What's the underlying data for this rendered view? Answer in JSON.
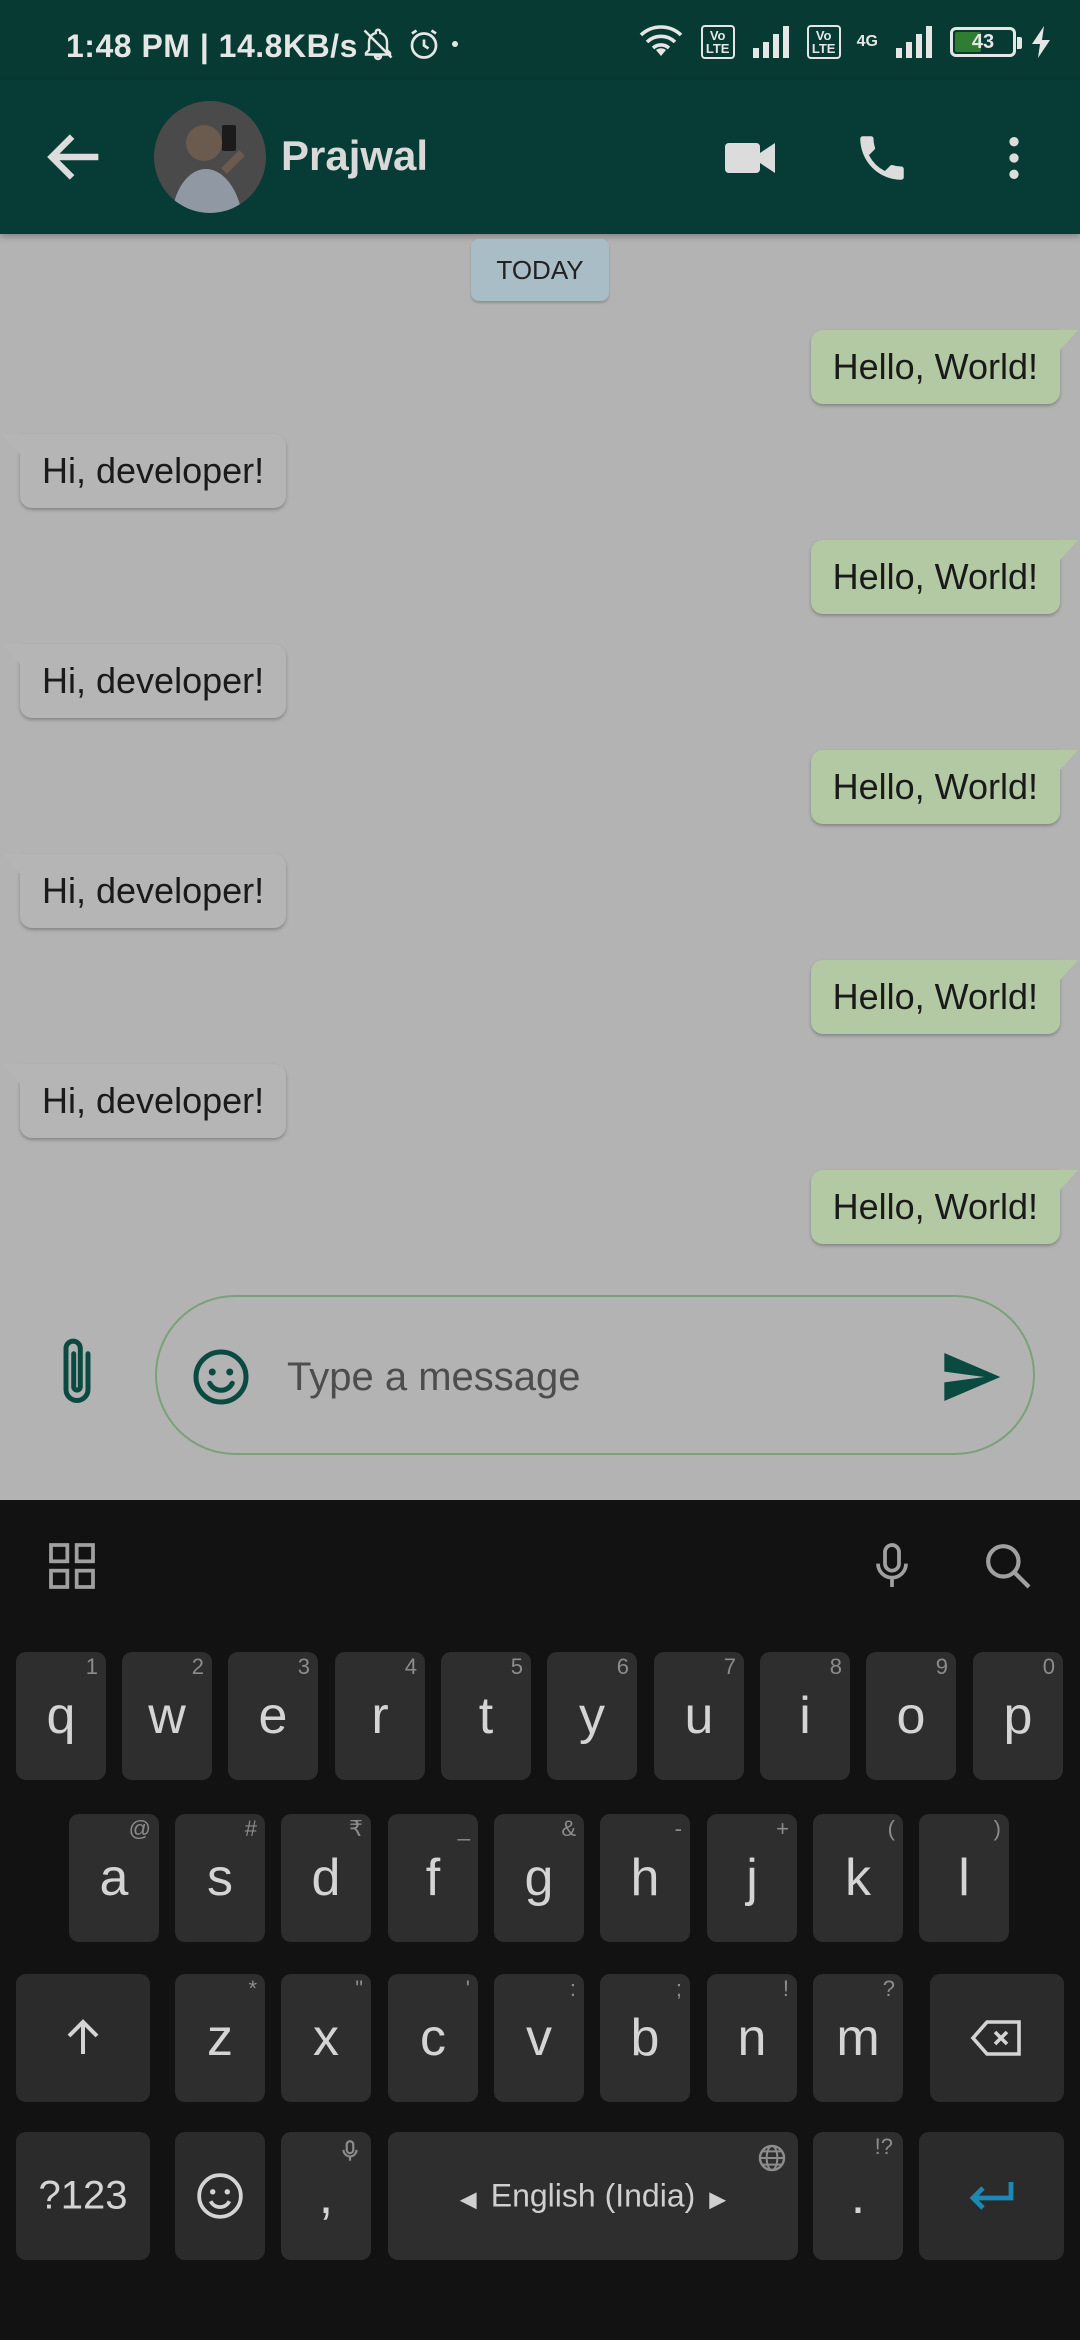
{
  "status_bar": {
    "time": "1:48 PM | 14.8KB/s",
    "volte_label": "Vo LTE",
    "network_4g": "4G",
    "battery": "43"
  },
  "header": {
    "contact_name": "Prajwal",
    "back_icon": "arrow-left-icon",
    "video_icon": "video-camera-icon",
    "call_icon": "phone-icon",
    "menu_icon": "more-vert-icon"
  },
  "chat": {
    "date_label": "TODAY",
    "messages": [
      {
        "dir": "out",
        "text": "Hello, World!"
      },
      {
        "dir": "in",
        "text": "Hi, developer!"
      },
      {
        "dir": "out",
        "text": "Hello, World!"
      },
      {
        "dir": "in",
        "text": "Hi, developer!"
      },
      {
        "dir": "out",
        "text": "Hello, World!"
      },
      {
        "dir": "in",
        "text": "Hi, developer!"
      },
      {
        "dir": "out",
        "text": "Hello, World!"
      },
      {
        "dir": "in",
        "text": "Hi, developer!"
      },
      {
        "dir": "out",
        "text": "Hello, World!"
      }
    ]
  },
  "composer": {
    "placeholder": "Type a message",
    "value": ""
  },
  "keyboard": {
    "row1": [
      {
        "k": "q",
        "h": "1"
      },
      {
        "k": "w",
        "h": "2"
      },
      {
        "k": "e",
        "h": "3"
      },
      {
        "k": "r",
        "h": "4"
      },
      {
        "k": "t",
        "h": "5"
      },
      {
        "k": "y",
        "h": "6"
      },
      {
        "k": "u",
        "h": "7"
      },
      {
        "k": "i",
        "h": "8"
      },
      {
        "k": "o",
        "h": "9"
      },
      {
        "k": "p",
        "h": "0"
      }
    ],
    "row2": [
      {
        "k": "a",
        "h": "@"
      },
      {
        "k": "s",
        "h": "#"
      },
      {
        "k": "d",
        "h": "₹"
      },
      {
        "k": "f",
        "h": "_"
      },
      {
        "k": "g",
        "h": "&"
      },
      {
        "k": "h",
        "h": "-"
      },
      {
        "k": "j",
        "h": "+"
      },
      {
        "k": "k",
        "h": "("
      },
      {
        "k": "l",
        "h": ")"
      }
    ],
    "row3": [
      {
        "k": "z",
        "h": "*"
      },
      {
        "k": "x",
        "h": "\""
      },
      {
        "k": "c",
        "h": "'"
      },
      {
        "k": "v",
        "h": ":"
      },
      {
        "k": "b",
        "h": ";"
      },
      {
        "k": "n",
        "h": "!"
      },
      {
        "k": "m",
        "h": "?"
      }
    ],
    "symbols_label": "?123",
    "comma": ",",
    "period": ".",
    "period_hint": "!?",
    "space_label": "English (India)",
    "accent_color": "#1e88b5"
  },
  "colors": {
    "header_bg": "#063c35",
    "outgoing_bubble": "#b3c9a3",
    "incoming_bubble": "#b5b5b5",
    "chat_bg": "#b3b3b3"
  }
}
